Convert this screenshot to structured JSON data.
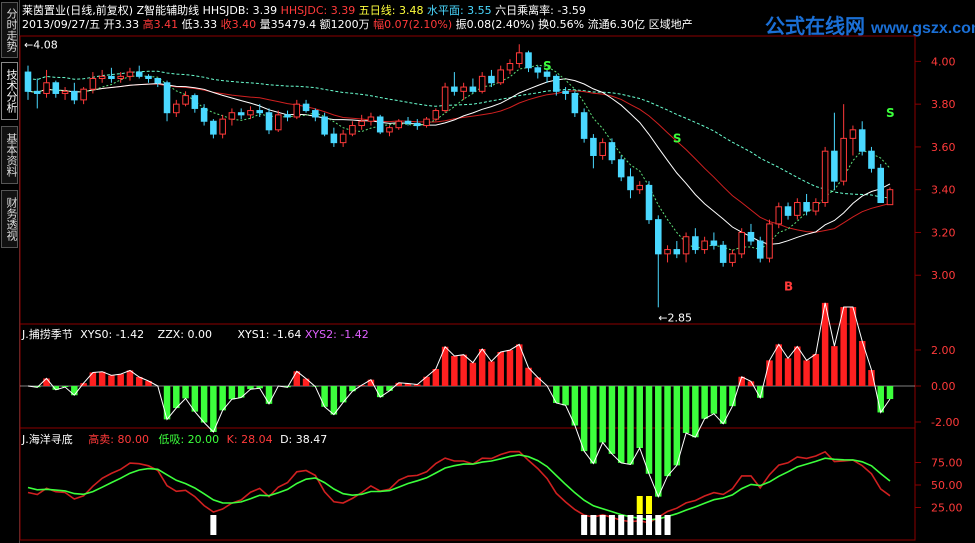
{
  "sidebar": {
    "tabs": [
      {
        "label": "分时走势",
        "active": false
      },
      {
        "label": "技术分析",
        "active": true
      },
      {
        "label": "基本资料",
        "active": false
      },
      {
        "label": "财务透视",
        "active": false
      }
    ]
  },
  "header": {
    "line1": {
      "stock": "莱茵置业(日线,前复权)",
      "indicator": "Z智能辅助线",
      "hhsjdb_label": "HHSJDB: 3.39",
      "hhsjdc_label": "HHSJDC: 3.39",
      "ma5_label": "五日线: 3.48",
      "level_label": "水平面: 3.55",
      "bias_label": "六日乘离率: -3.59"
    },
    "line2": {
      "date": "2013/09/27/五",
      "open_label": "开3.33",
      "high_label": "高3.41",
      "low_label": "低3.33",
      "close_label": "收3.40",
      "volume_label": "量35479.4",
      "amount_label": "额1200万",
      "change_label": "幅0.07(2.10%)",
      "amplitude_label": "振0.08(2.40%)",
      "turnover_label": "换0.56%",
      "float_label": "流通6.30亿",
      "sector_label": "区域地产"
    }
  },
  "watermark": {
    "text": "公式在线网",
    "url": "www.gszx.com.cn"
  },
  "main_panel": {
    "axis_labels": [
      "4.00",
      "3.80",
      "3.60",
      "3.40",
      "3.20",
      "3.00"
    ],
    "high_marker": "4.08",
    "low_marker": "2.85",
    "buy_sell": {
      "s": "S",
      "b": "B"
    }
  },
  "panel2": {
    "title": "J.捕捞季节",
    "xys0_label": "XYS0: -1.42",
    "zzx_label": "ZZX: 0.00",
    "xys1_label": "XYS1: -1.64",
    "xys2_label": "XYS2: -1.42",
    "axis_labels": [
      "2.00",
      "0.00",
      "-2.00"
    ]
  },
  "panel3": {
    "title": "J.海洋寻底",
    "sell_label": "高卖: 80.00",
    "buy_label": "低吸: 20.00",
    "k_label": "K: 28.04",
    "d_label": "D: 38.47",
    "axis_labels": [
      "75.00",
      "50.00",
      "25.00"
    ]
  },
  "colors": {
    "up": "#ff3a3a",
    "down": "#4ad8ff",
    "grid": "#8b0000",
    "ma_white": "#ffffff",
    "ma_yellow": "#ffff3c",
    "ma_red": "#d02020",
    "ma_cyan_dash": "#6affd0"
  },
  "chart_data": {
    "type": "candlestick",
    "ylim": [
      2.8,
      4.1
    ],
    "candles": [
      [
        3.95,
        3.98,
        3.82,
        3.86
      ],
      [
        3.86,
        3.92,
        3.78,
        3.85
      ],
      [
        3.85,
        3.96,
        3.83,
        3.9
      ],
      [
        3.9,
        3.91,
        3.83,
        3.85
      ],
      [
        3.85,
        3.88,
        3.82,
        3.86
      ],
      [
        3.86,
        3.9,
        3.8,
        3.82
      ],
      [
        3.82,
        3.88,
        3.8,
        3.87
      ],
      [
        3.87,
        3.95,
        3.85,
        3.92
      ],
      [
        3.92,
        3.96,
        3.9,
        3.93
      ],
      [
        3.93,
        3.97,
        3.9,
        3.92
      ],
      [
        3.92,
        3.95,
        3.9,
        3.93
      ],
      [
        3.93,
        3.97,
        3.91,
        3.95
      ],
      [
        3.95,
        3.98,
        3.92,
        3.93
      ],
      [
        3.93,
        3.94,
        3.9,
        3.92
      ],
      [
        3.92,
        3.92,
        3.88,
        3.9
      ],
      [
        3.9,
        3.91,
        3.72,
        3.76
      ],
      [
        3.76,
        3.82,
        3.74,
        3.8
      ],
      [
        3.8,
        3.86,
        3.79,
        3.84
      ],
      [
        3.84,
        3.85,
        3.76,
        3.78
      ],
      [
        3.78,
        3.8,
        3.7,
        3.72
      ],
      [
        3.72,
        3.73,
        3.64,
        3.66
      ],
      [
        3.66,
        3.75,
        3.64,
        3.73
      ],
      [
        3.73,
        3.78,
        3.7,
        3.76
      ],
      [
        3.76,
        3.78,
        3.73,
        3.75
      ],
      [
        3.75,
        3.79,
        3.73,
        3.77
      ],
      [
        3.77,
        3.8,
        3.74,
        3.76
      ],
      [
        3.76,
        3.78,
        3.66,
        3.68
      ],
      [
        3.68,
        3.77,
        3.67,
        3.75
      ],
      [
        3.75,
        3.77,
        3.72,
        3.74
      ],
      [
        3.74,
        3.82,
        3.73,
        3.8
      ],
      [
        3.8,
        3.82,
        3.76,
        3.77
      ],
      [
        3.77,
        3.78,
        3.72,
        3.74
      ],
      [
        3.74,
        3.76,
        3.65,
        3.66
      ],
      [
        3.66,
        3.69,
        3.6,
        3.62
      ],
      [
        3.62,
        3.68,
        3.6,
        3.66
      ],
      [
        3.66,
        3.72,
        3.65,
        3.7
      ],
      [
        3.7,
        3.75,
        3.68,
        3.72
      ],
      [
        3.72,
        3.76,
        3.7,
        3.74
      ],
      [
        3.74,
        3.75,
        3.66,
        3.67
      ],
      [
        3.67,
        3.7,
        3.65,
        3.69
      ],
      [
        3.69,
        3.73,
        3.68,
        3.72
      ],
      [
        3.72,
        3.74,
        3.7,
        3.71
      ],
      [
        3.71,
        3.73,
        3.68,
        3.7
      ],
      [
        3.7,
        3.74,
        3.69,
        3.73
      ],
      [
        3.73,
        3.78,
        3.72,
        3.77
      ],
      [
        3.77,
        3.9,
        3.76,
        3.88
      ],
      [
        3.88,
        3.95,
        3.84,
        3.86
      ],
      [
        3.86,
        3.9,
        3.82,
        3.88
      ],
      [
        3.88,
        3.92,
        3.85,
        3.86
      ],
      [
        3.86,
        3.95,
        3.85,
        3.93
      ],
      [
        3.93,
        3.96,
        3.88,
        3.9
      ],
      [
        3.9,
        3.98,
        3.89,
        3.96
      ],
      [
        3.96,
        4.01,
        3.94,
        3.99
      ],
      [
        3.99,
        4.08,
        3.97,
        4.04
      ],
      [
        4.04,
        4.05,
        3.95,
        3.97
      ],
      [
        3.97,
        3.98,
        3.92,
        3.95
      ],
      [
        3.95,
        3.96,
        3.9,
        3.93
      ],
      [
        3.93,
        3.94,
        3.84,
        3.86
      ],
      [
        3.86,
        3.88,
        3.82,
        3.85
      ],
      [
        3.85,
        3.86,
        3.74,
        3.76
      ],
      [
        3.76,
        3.78,
        3.62,
        3.64
      ],
      [
        3.64,
        3.66,
        3.5,
        3.56
      ],
      [
        3.56,
        3.64,
        3.54,
        3.62
      ],
      [
        3.62,
        3.64,
        3.52,
        3.54
      ],
      [
        3.54,
        3.56,
        3.44,
        3.46
      ],
      [
        3.46,
        3.5,
        3.36,
        3.4
      ],
      [
        3.4,
        3.44,
        3.38,
        3.42
      ],
      [
        3.42,
        3.44,
        3.24,
        3.26
      ],
      [
        3.26,
        3.28,
        2.85,
        3.1
      ],
      [
        3.1,
        3.14,
        3.06,
        3.12
      ],
      [
        3.12,
        3.16,
        3.08,
        3.1
      ],
      [
        3.1,
        3.2,
        3.06,
        3.18
      ],
      [
        3.18,
        3.22,
        3.1,
        3.12
      ],
      [
        3.12,
        3.18,
        3.1,
        3.16
      ],
      [
        3.16,
        3.2,
        3.12,
        3.14
      ],
      [
        3.14,
        3.16,
        3.04,
        3.06
      ],
      [
        3.06,
        3.12,
        3.04,
        3.1
      ],
      [
        3.1,
        3.22,
        3.08,
        3.2
      ],
      [
        3.2,
        3.24,
        3.14,
        3.16
      ],
      [
        3.16,
        3.18,
        3.06,
        3.08
      ],
      [
        3.08,
        3.26,
        3.06,
        3.24
      ],
      [
        3.24,
        3.34,
        3.22,
        3.32
      ],
      [
        3.32,
        3.34,
        3.26,
        3.28
      ],
      [
        3.28,
        3.36,
        3.26,
        3.34
      ],
      [
        3.34,
        3.38,
        3.28,
        3.3
      ],
      [
        3.3,
        3.36,
        3.28,
        3.34
      ],
      [
        3.34,
        3.6,
        3.32,
        3.58
      ],
      [
        3.58,
        3.76,
        3.4,
        3.44
      ],
      [
        3.44,
        3.8,
        3.42,
        3.64
      ],
      [
        3.64,
        3.7,
        3.56,
        3.68
      ],
      [
        3.68,
        3.72,
        3.56,
        3.58
      ],
      [
        3.58,
        3.6,
        3.48,
        3.5
      ],
      [
        3.5,
        3.52,
        3.38,
        3.34
      ],
      [
        3.33,
        3.41,
        3.33,
        3.4
      ]
    ]
  }
}
